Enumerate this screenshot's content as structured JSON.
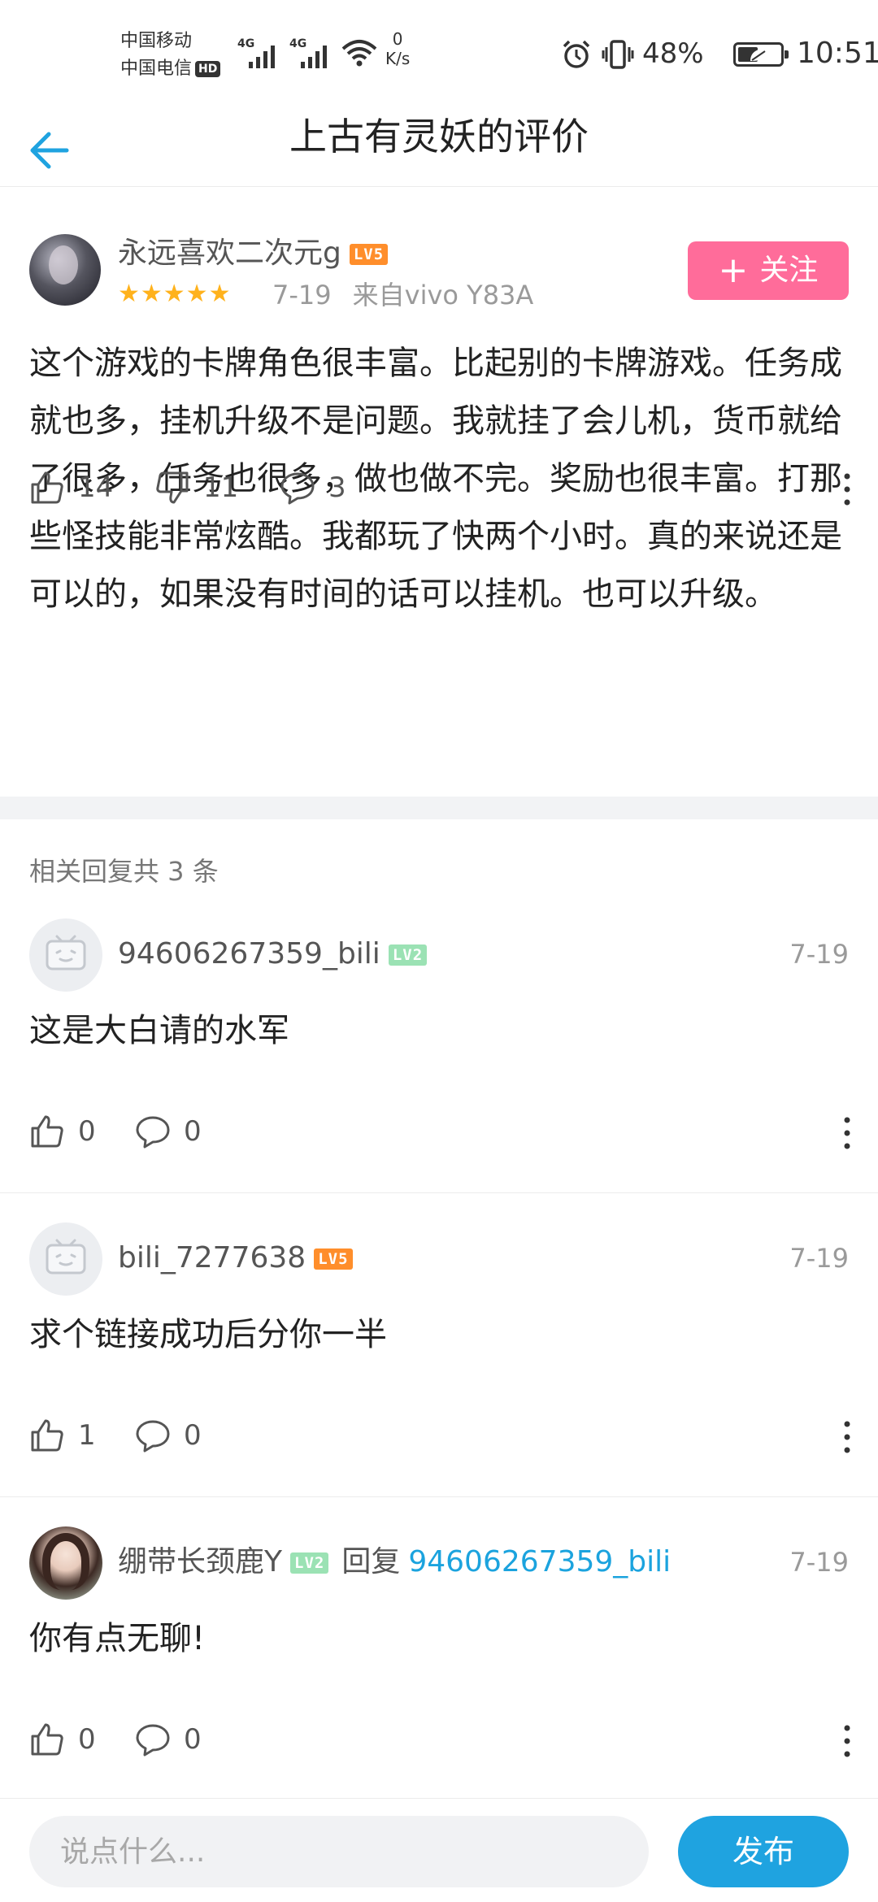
{
  "status_bar": {
    "carrier_1": "中国移动",
    "carrier_2": "中国电信",
    "hd_badge": "HD",
    "network_1": "4G",
    "network_2": "4G",
    "speed_value": "0",
    "speed_unit": "K/s",
    "battery_percent": "48%",
    "battery_level": 0.48,
    "time": "10:51",
    "icons": [
      "signal-icon",
      "wifi-icon",
      "alarm-icon",
      "vibrate-icon",
      "battery-icon"
    ]
  },
  "header": {
    "back_icon": "back-arrow-icon",
    "title": "上古有灵妖的评价"
  },
  "review": {
    "username": "永远喜欢二次元g",
    "level": "LV5",
    "rating_stars": 5,
    "stars_text": "★★★★★",
    "date": "7-19",
    "device": "来自vivo Y83A",
    "follow_label": "关注",
    "follow_plus": "+",
    "body": "这个游戏的卡牌角色很丰富。比起别的卡牌游戏。任务成就也多，挂机升级不是问题。我就挂了会儿机，货币就给了很多，任务也很多，做也做不完。奖励也很丰富。打那些怪技能非常炫酷。我都玩了快两个小时。真的来说还是可以的，如果没有时间的话可以挂机。也可以升级。",
    "likes": "14",
    "dislikes": "11",
    "comments": "3"
  },
  "replies_header": "相关回复共 3 条",
  "replies": [
    {
      "username": "94606267359_bili",
      "level": "LV2",
      "date": "7-19",
      "text": "这是大白请的水军",
      "likes": "0",
      "comments": "0"
    },
    {
      "username": "bili_7277638",
      "level": "LV5",
      "date": "7-19",
      "text": "求个链接成功后分你一半",
      "likes": "1",
      "comments": "0"
    },
    {
      "username": "绷带长颈鹿Y",
      "level": "LV2",
      "reply_word": "回复",
      "reply_to": "94606267359_bili",
      "date": "7-19",
      "text": "你有点无聊!",
      "likes": "0",
      "comments": "0"
    }
  ],
  "bottom_bar": {
    "input_placeholder": "说点什么...",
    "publish_label": "发布"
  },
  "colors": {
    "accent_blue": "#1fa3e0",
    "follow_pink": "#ff6c9a",
    "star_orange": "#ffb21c",
    "lv5_orange": "#ff8e2b",
    "lv2_green": "#9be2b4",
    "link_blue": "#1ba3de"
  }
}
